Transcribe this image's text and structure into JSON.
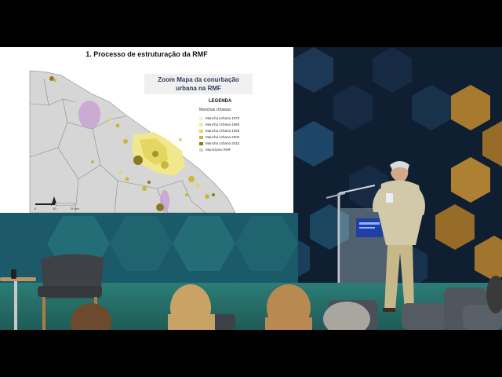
{
  "slide": {
    "title": "1. Processo de estruturação da RMF",
    "zoom_title_line1": "Zoom Mapa da conurbação",
    "zoom_title_line2": "urbana na RMF",
    "legend_title": "LEGENDA",
    "legend_subtitle": "Manchas Urbanas",
    "legend_items": [
      {
        "label": "Mancha Urbana 1970",
        "color": "#f5f2c8"
      },
      {
        "label": "Mancha Urbana 1980",
        "color": "#eee7a0"
      },
      {
        "label": "Mancha Urbana 1990",
        "color": "#e3d86a"
      },
      {
        "label": "Mancha Urbana 2000",
        "color": "#c9b83a"
      },
      {
        "label": "Mancha Urbana 2013",
        "color": "#8a7a1e"
      },
      {
        "label": "Municípios RMF",
        "color": "#d0d0d0"
      }
    ],
    "scale_labels": [
      "0",
      "10",
      "20 km"
    ]
  },
  "colors": {
    "wall_dark": "#13243a",
    "hex_gold": "#b9852e",
    "floor_teal": "#2c7d76"
  }
}
